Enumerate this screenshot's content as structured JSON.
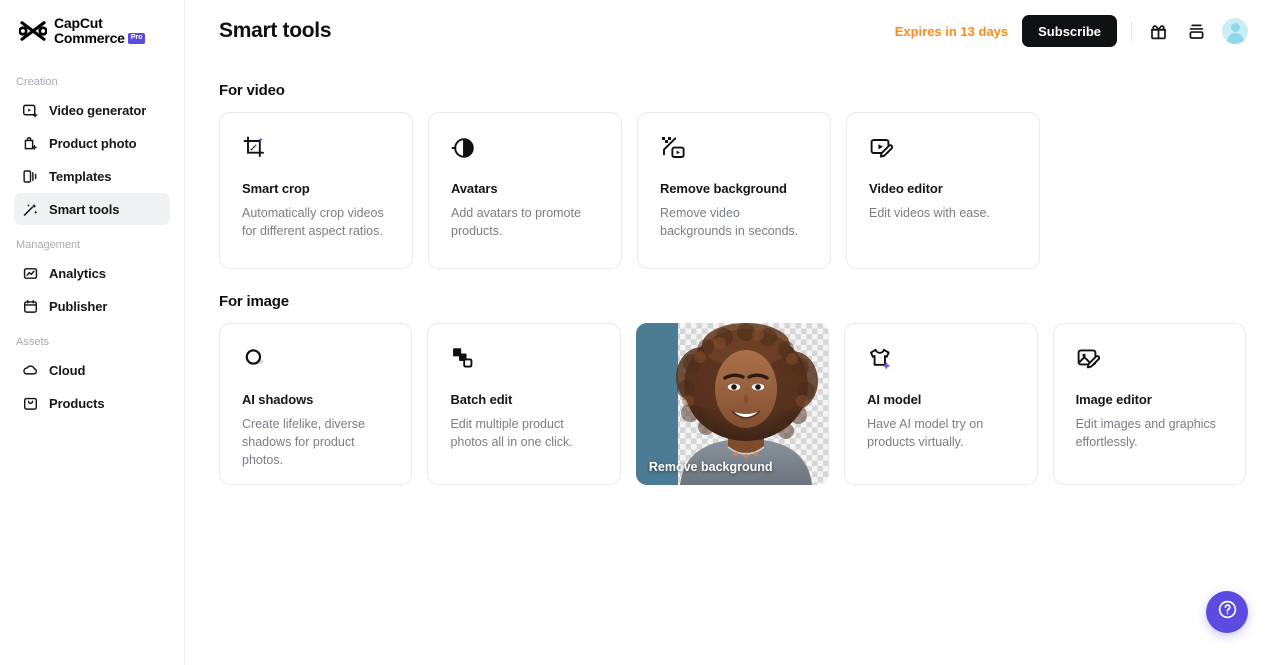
{
  "brand": {
    "line1": "CapCut",
    "line2": "Commerce",
    "badge": "Pro",
    "badge_color": "#5B4BE0"
  },
  "sidebar": {
    "groups": [
      {
        "label": "Creation",
        "items": [
          {
            "label": "Video generator",
            "icon": "video-generator-icon",
            "active": false
          },
          {
            "label": "Product photo",
            "icon": "product-photo-icon",
            "active": false
          },
          {
            "label": "Templates",
            "icon": "templates-icon",
            "active": false
          },
          {
            "label": "Smart tools",
            "icon": "smart-tools-icon",
            "active": true
          }
        ]
      },
      {
        "label": "Management",
        "items": [
          {
            "label": "Analytics",
            "icon": "analytics-icon",
            "active": false
          },
          {
            "label": "Publisher",
            "icon": "publisher-icon",
            "active": false
          }
        ]
      },
      {
        "label": "Assets",
        "items": [
          {
            "label": "Cloud",
            "icon": "cloud-icon",
            "active": false
          },
          {
            "label": "Products",
            "icon": "products-icon",
            "active": false
          }
        ]
      }
    ]
  },
  "header": {
    "title": "Smart tools",
    "expires_text": "Expires in 13 days",
    "expires_color": "#FF8A19",
    "subscribe_label": "Subscribe",
    "icons": [
      "gift-icon",
      "stack-icon"
    ],
    "avatar": "user-avatar"
  },
  "sections": [
    {
      "title": "For video",
      "cards": [
        {
          "icon": "smart-crop-icon",
          "title": "Smart crop",
          "desc": "Automatically crop videos for different aspect ratios."
        },
        {
          "icon": "avatars-icon",
          "title": "Avatars",
          "desc": "Add avatars to promote products."
        },
        {
          "icon": "remove-background-icon",
          "title": "Remove background",
          "desc": "Remove video backgrounds in seconds."
        },
        {
          "icon": "video-editor-icon",
          "title": "Video editor",
          "desc": "Edit videos with ease."
        }
      ]
    },
    {
      "title": "For image",
      "cards": [
        {
          "icon": "ai-shadows-icon",
          "title": "AI shadows",
          "desc": "Create lifelike, diverse shadows for product photos."
        },
        {
          "icon": "batch-edit-icon",
          "title": "Batch edit",
          "desc": "Edit multiple product photos all in one click."
        },
        {
          "type": "preview",
          "title": "Remove background",
          "desc": ""
        },
        {
          "icon": "ai-model-icon",
          "title": "AI model",
          "desc": "Have AI model try on products virtually."
        },
        {
          "icon": "image-editor-icon",
          "title": "Image editor",
          "desc": "Edit images and graphics effortlessly."
        }
      ]
    }
  ],
  "help": {
    "icon": "help-circle-icon",
    "color": "#5B4BE0"
  }
}
